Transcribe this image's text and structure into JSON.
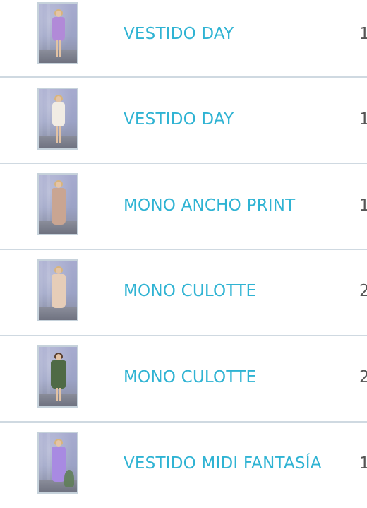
{
  "products": [
    {
      "name": "VESTIDO DAY",
      "qty": "1",
      "image": "model-lilac-short-dress-photo",
      "dress_color": "#b18ad8"
    },
    {
      "name": "VESTIDO DAY",
      "qty": "1",
      "image": "model-white-short-dress-photo",
      "dress_color": "#f1ece4"
    },
    {
      "name": "MONO ANCHO PRINT",
      "qty": "1",
      "image": "model-printed-wide-jumpsuit-photo",
      "dress_color": "#c9a592"
    },
    {
      "name": "MONO CULOTTE",
      "qty": "2",
      "image": "model-beige-culotte-jumpsuit-photo",
      "dress_color": "#e6cdb8"
    },
    {
      "name": "MONO CULOTTE",
      "qty": "2",
      "image": "model-green-culotte-jumpsuit-photo",
      "dress_color": "#4f6a45"
    },
    {
      "name": "VESTIDO MIDI FANTASÍA",
      "qty": "1",
      "image": "model-lilac-midi-dress-photo",
      "dress_color": "#a88ae2"
    }
  ],
  "colors": {
    "link": "#2fb3d3",
    "divider": "#cfd9e1",
    "quantity_text": "#555555"
  }
}
